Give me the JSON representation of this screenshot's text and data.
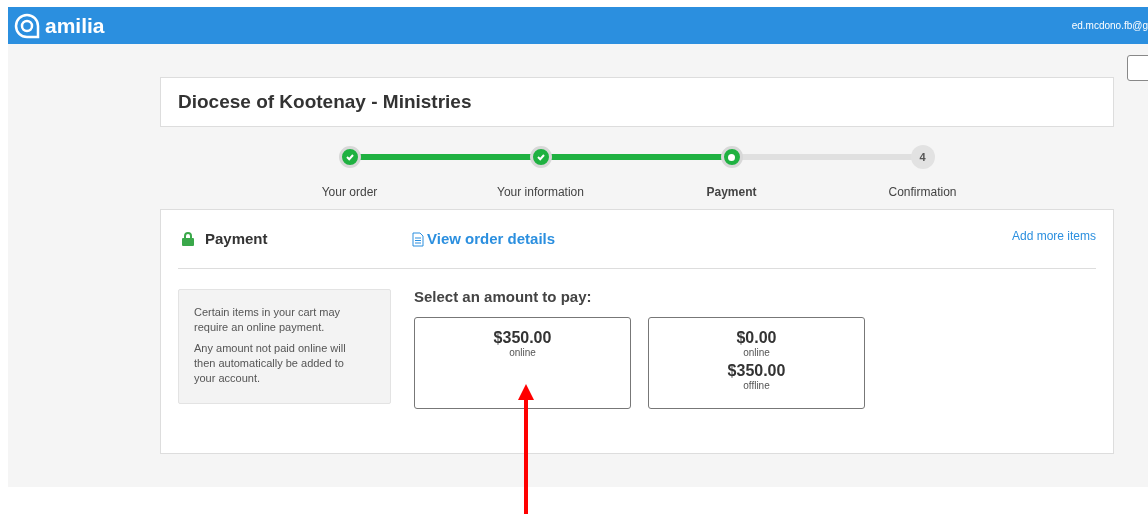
{
  "header": {
    "brand": "amilia",
    "user": "ed.mcdono.fb@g"
  },
  "title": "Diocese of Kootenay - Ministries",
  "steps": [
    {
      "label": "Your order",
      "kind": "done"
    },
    {
      "label": "Your information",
      "kind": "done"
    },
    {
      "label": "Payment",
      "kind": "current"
    },
    {
      "label": "Confirmation",
      "kind": "todo",
      "number": "4"
    }
  ],
  "payment": {
    "heading": "Payment",
    "view_link": "View order details",
    "add_link": "Add more items",
    "notes": [
      "Certain items in your cart may require an online payment.",
      "Any amount not paid online will then automatically be added to your account."
    ],
    "prompt": "Select an amount to pay:",
    "options": [
      {
        "amounts": [
          {
            "value": "$350.00",
            "label": "online"
          }
        ]
      },
      {
        "amounts": [
          {
            "value": "$0.00",
            "label": "online"
          },
          {
            "value": "$350.00",
            "label": "offline"
          }
        ]
      }
    ]
  }
}
